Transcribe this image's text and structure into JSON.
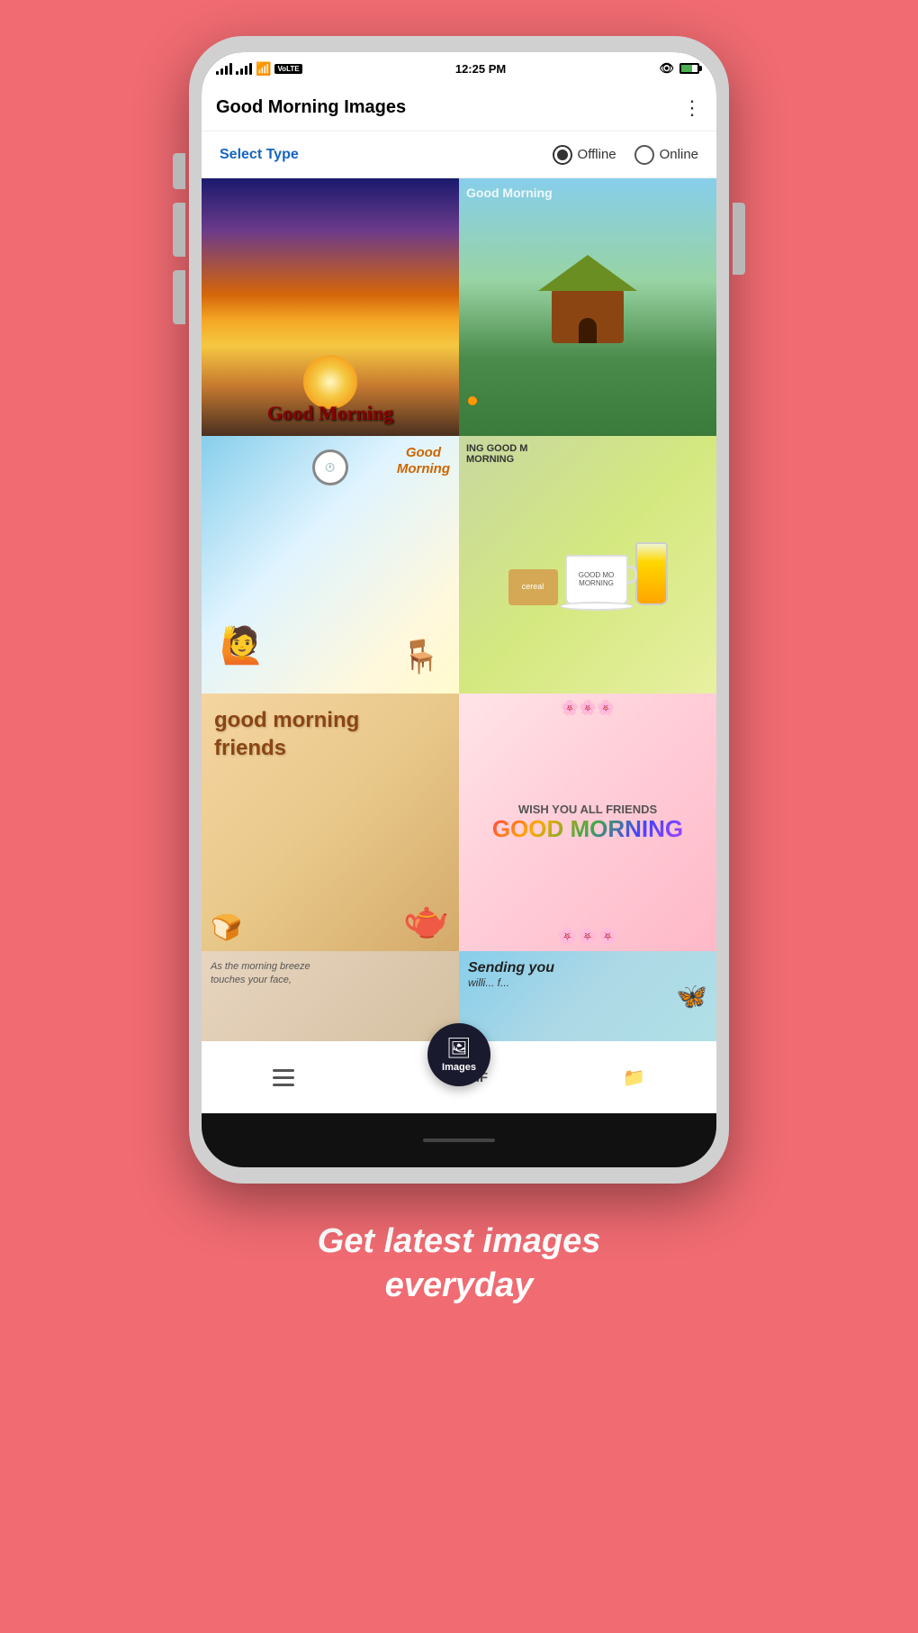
{
  "status_bar": {
    "signal1": "signal",
    "signal2": "signal",
    "wifi": "wifi",
    "volte": "VoLTE",
    "time": "12:25 PM",
    "eye": "eye",
    "battery": "battery"
  },
  "app_bar": {
    "title": "Good Morning Images",
    "more_menu_label": "⋮"
  },
  "type_selector": {
    "label": "Select Type",
    "option_offline": "Offline",
    "option_online": "Online",
    "selected": "offline"
  },
  "images": [
    {
      "id": 1,
      "alt": "Sunrise good morning"
    },
    {
      "id": 2,
      "alt": "Cottage good morning"
    },
    {
      "id": 3,
      "alt": "Cartoon good morning"
    },
    {
      "id": 4,
      "alt": "Coffee good morning"
    },
    {
      "id": 5,
      "alt": "Good morning friends"
    },
    {
      "id": 6,
      "alt": "Wish you all friends good morning"
    },
    {
      "id": 7,
      "alt": "Morning breeze"
    },
    {
      "id": 8,
      "alt": "Sending you"
    }
  ],
  "bottom_nav": {
    "hamburger_label": "menu",
    "images_label": "Images",
    "gif_label": "GIF",
    "download_label": "download"
  },
  "friends_text": {
    "line1": "good morning",
    "line2": "friends"
  },
  "wish_text": {
    "line1": "WISH YOU ALL FRIENDS",
    "line2": "GOOD MORNING"
  },
  "breeze_text": {
    "line1": "As the morning breeze",
    "line2": "touches your face,"
  },
  "sending_text": {
    "line1": "Sending you"
  },
  "tagline": {
    "line1": "Get latest images",
    "line2": "everyday"
  },
  "sunrise_text": "Good Morning",
  "cottage_watermark": "Good Morning",
  "cartoon_text_line1": "Good",
  "cartoon_text_line2": "Morning",
  "coffee_text": "ING GOOD M..."
}
